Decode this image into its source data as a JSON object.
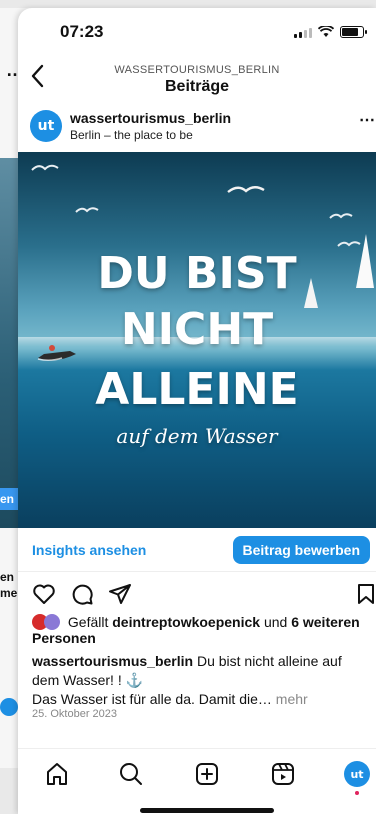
{
  "status": {
    "time": "07:23"
  },
  "nav": {
    "subtitle": "WASSERTOURISMUS_BERLIN",
    "title": "Beiträge"
  },
  "post": {
    "account": "wassertourismus_berlin",
    "location": "Berlin – the place to be",
    "avatar_text": "ut",
    "image_text": [
      "DU BIST",
      "NICHT",
      "ALLEINE",
      "auf dem Wasser"
    ],
    "insights_label": "Insights ansehen",
    "promote_label": "Beitrag bewerben",
    "likes_prefix": "Gefällt ",
    "likes_user": "deintreptowkoepenick",
    "likes_mid": " und ",
    "likes_more": "6 weiteren Personen",
    "caption_user": "wassertourismus_berlin",
    "caption_text": " Du bist nicht alleine auf dem Wasser! ! ⚓",
    "caption_line2": "Das Wasser ist für alle da. Damit die…",
    "caption_more": " mehr",
    "date": "25. Oktober 2023"
  },
  "background_card": {
    "fragments": [
      "en",
      "en",
      "mer"
    ]
  },
  "colors": {
    "accent": "#1d8fe3"
  }
}
